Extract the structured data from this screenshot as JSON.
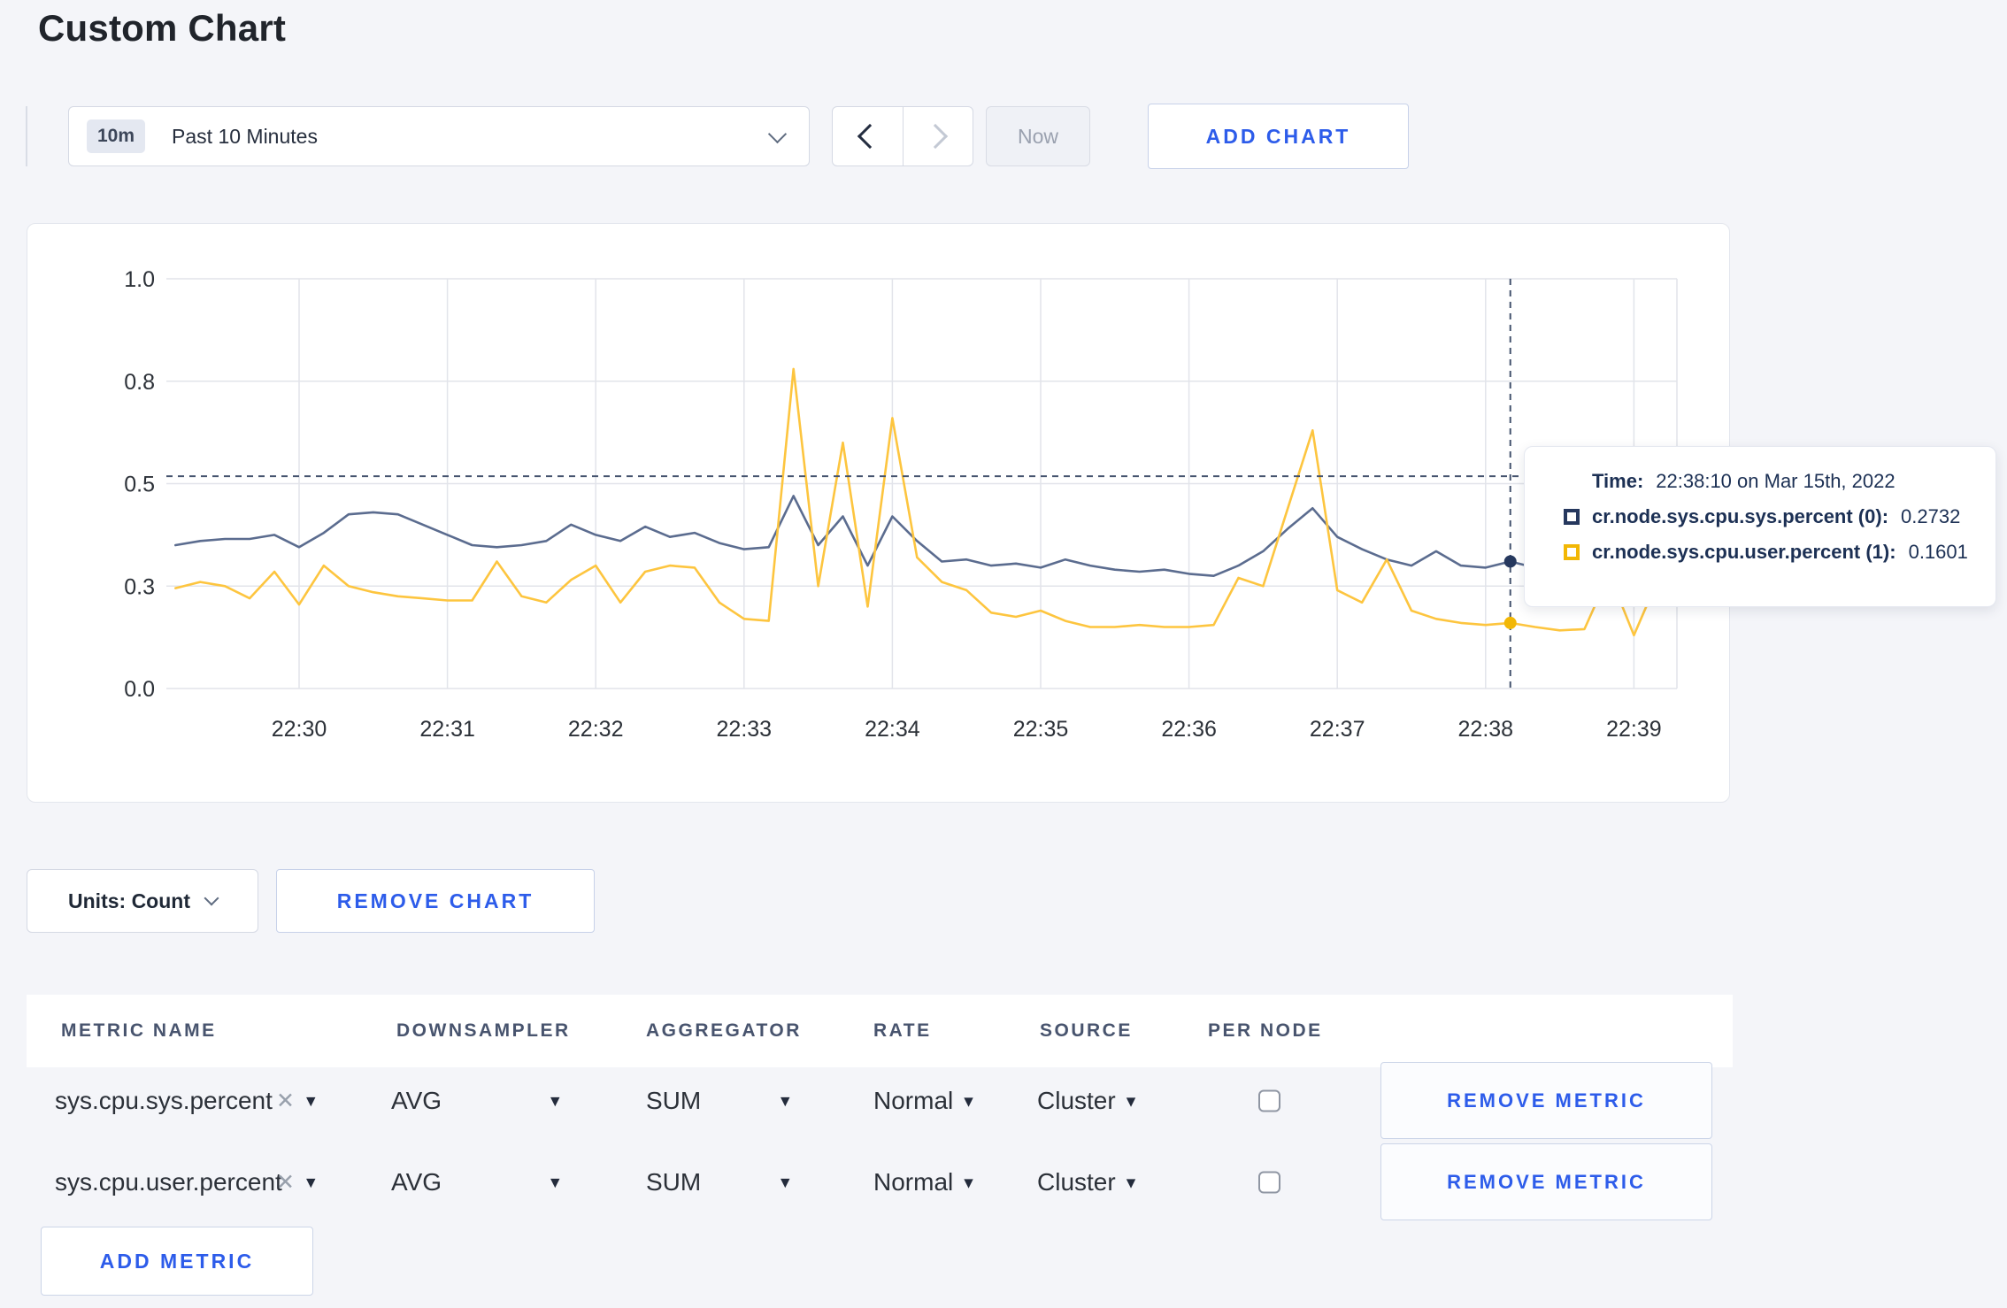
{
  "page": {
    "title": "Custom Chart"
  },
  "toolbar": {
    "range_badge": "10m",
    "range_label": "Past 10 Minutes",
    "now_label": "Now",
    "add_chart_label": "ADD CHART"
  },
  "chart_data": {
    "type": "line",
    "title": "",
    "xlabel": "",
    "ylabel": "",
    "ylim": [
      0,
      1
    ],
    "grid": true,
    "y_ticks": [
      {
        "value": 0,
        "label": "0.0"
      },
      {
        "value": 0.25,
        "label": "0.3"
      },
      {
        "value": 0.5,
        "label": "0.5"
      },
      {
        "value": 0.75,
        "label": "0.8"
      },
      {
        "value": 1.0,
        "label": "1.0"
      }
    ],
    "x_ticks": [
      "22:30",
      "22:31",
      "22:32",
      "22:33",
      "22:34",
      "22:35",
      "22:36",
      "22:37",
      "22:38",
      "22:39"
    ],
    "x_start_min": -0.8333,
    "x_step_min": 0.166667,
    "series": [
      {
        "name": "cr.node.sys.cpu.sys.percent",
        "node": "(0)",
        "color": "#5b6c8f",
        "values": [
          0.35,
          0.36,
          0.365,
          0.365,
          0.375,
          0.345,
          0.38,
          0.425,
          0.43,
          0.425,
          0.4,
          0.375,
          0.35,
          0.345,
          0.35,
          0.36,
          0.4,
          0.375,
          0.36,
          0.395,
          0.37,
          0.38,
          0.355,
          0.34,
          0.345,
          0.47,
          0.35,
          0.42,
          0.3,
          0.42,
          0.36,
          0.31,
          0.315,
          0.3,
          0.305,
          0.295,
          0.315,
          0.3,
          0.29,
          0.285,
          0.29,
          0.28,
          0.275,
          0.3,
          0.335,
          0.39,
          0.44,
          0.37,
          0.34,
          0.315,
          0.3,
          0.335,
          0.3,
          0.295,
          0.31,
          0.295,
          0.285,
          0.295,
          0.305,
          0.3,
          0.305
        ]
      },
      {
        "name": "cr.node.sys.cpu.user.percent",
        "node": "(1)",
        "color": "#fdc53f",
        "values": [
          0.245,
          0.26,
          0.25,
          0.22,
          0.285,
          0.205,
          0.3,
          0.25,
          0.235,
          0.225,
          0.22,
          0.215,
          0.215,
          0.31,
          0.225,
          0.21,
          0.265,
          0.3,
          0.21,
          0.285,
          0.3,
          0.295,
          0.21,
          0.17,
          0.165,
          0.78,
          0.25,
          0.6,
          0.2,
          0.66,
          0.32,
          0.26,
          0.24,
          0.185,
          0.175,
          0.19,
          0.165,
          0.15,
          0.15,
          0.155,
          0.15,
          0.15,
          0.155,
          0.27,
          0.25,
          0.44,
          0.63,
          0.24,
          0.21,
          0.315,
          0.19,
          0.17,
          0.16,
          0.155,
          0.16,
          0.15,
          0.142,
          0.145,
          0.28,
          0.13,
          0.27
        ]
      }
    ],
    "crosshair": {
      "x_min": 8.1667,
      "hover_value": 0.518,
      "point_index": 54,
      "color": "#44536e"
    },
    "legend_position": "tooltip"
  },
  "tooltip": {
    "time_label": "Time:",
    "time_value": "22:38:10 on Mar 15th, 2022",
    "rows": [
      {
        "label": "cr.node.sys.cpu.sys.percent (0):",
        "value": "0.2732",
        "color": "#26385e"
      },
      {
        "label": "cr.node.sys.cpu.user.percent (1):",
        "value": "0.1601",
        "color": "#f2b705"
      }
    ]
  },
  "units_bar": {
    "units_label": "Units: Count",
    "remove_chart_label": "REMOVE CHART"
  },
  "metrics_table": {
    "headers": [
      "METRIC NAME",
      "DOWNSAMPLER",
      "AGGREGATOR",
      "RATE",
      "SOURCE",
      "PER NODE"
    ],
    "rows": [
      {
        "metric": "sys.cpu.sys.percent",
        "downsampler": "AVG",
        "aggregator": "SUM",
        "rate": "Normal",
        "source": "Cluster",
        "per_node_checked": false,
        "remove_label": "REMOVE METRIC"
      },
      {
        "metric": "sys.cpu.user.percent",
        "downsampler": "AVG",
        "aggregator": "SUM",
        "rate": "Normal",
        "source": "Cluster",
        "per_node_checked": false,
        "remove_label": "REMOVE METRIC"
      }
    ],
    "add_metric_label": "ADD METRIC"
  }
}
